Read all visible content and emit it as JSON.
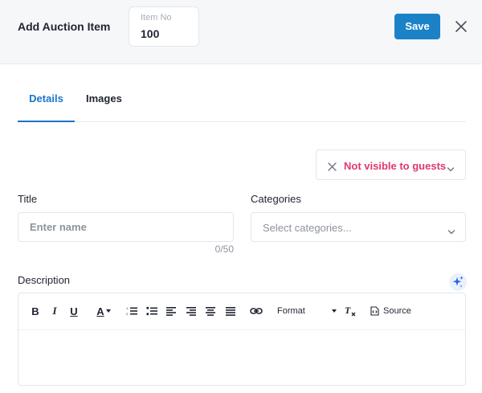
{
  "header": {
    "title": "Add Auction Item",
    "item_no_label": "Item No",
    "item_no_value": "100",
    "save_label": "Save"
  },
  "tabs": [
    {
      "label": "Details",
      "active": true
    },
    {
      "label": "Images",
      "active": false
    }
  ],
  "visibility": {
    "label": "Not visible to guests",
    "color": "#e0386b"
  },
  "form": {
    "title_label": "Title",
    "title_placeholder": "Enter name",
    "title_counter": "0/50",
    "categories_label": "Categories",
    "categories_placeholder": "Select categories...",
    "description_label": "Description"
  },
  "editor_toolbar": {
    "bold": "B",
    "italic": "I",
    "underline": "U",
    "font_color": "A",
    "format_label": "Format",
    "source_label": "Source"
  },
  "colors": {
    "accent": "#1b82c8",
    "tab_active": "#1b74c9"
  },
  "icons": [
    "close-icon",
    "chevron-down-icon",
    "sparkle-icon",
    "ordered-list-icon",
    "bullet-list-icon",
    "align-left-icon",
    "align-right-icon",
    "align-center-icon",
    "align-justify-icon",
    "link-icon",
    "clear-format-icon",
    "source-code-icon"
  ]
}
